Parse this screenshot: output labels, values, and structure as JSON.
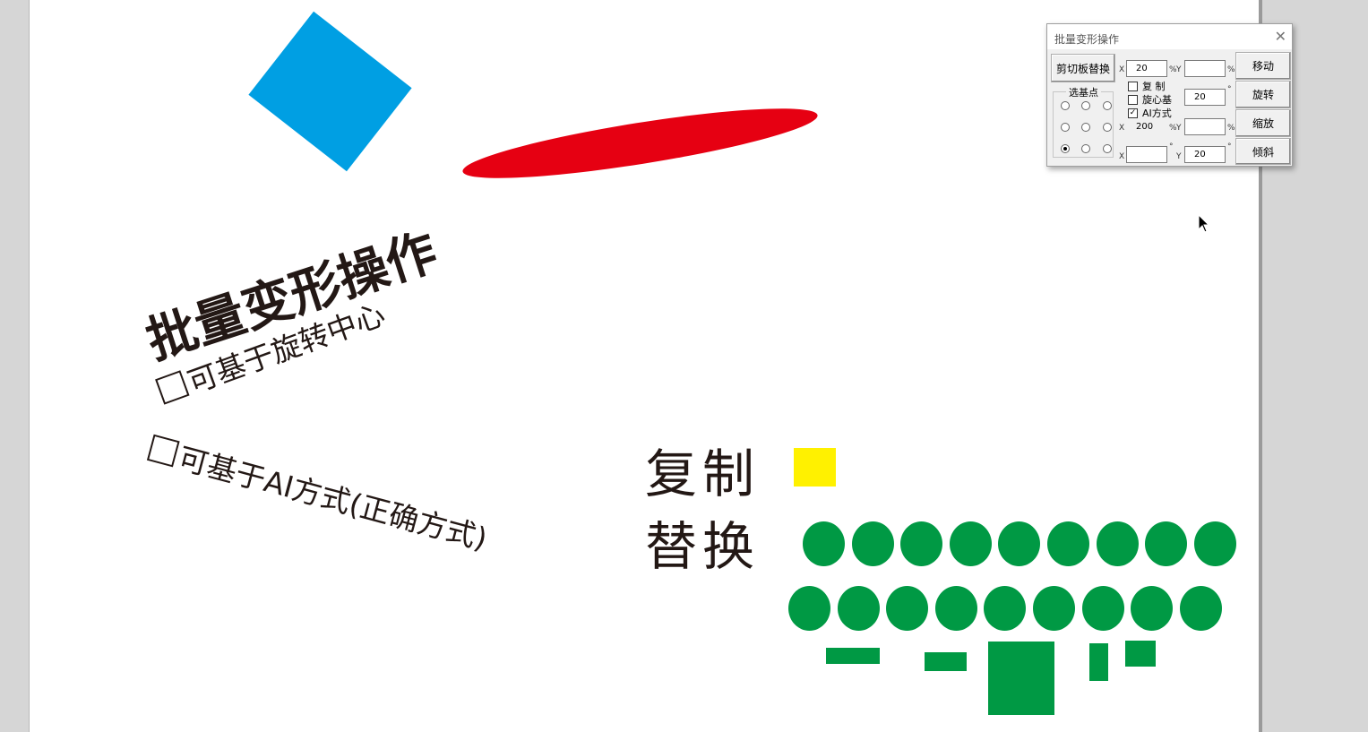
{
  "canvas": {
    "colors": {
      "blue": "#009FE3",
      "red": "#E60012",
      "yellow": "#FFF100",
      "green": "#009944",
      "text": "#231815"
    },
    "title": "批量变形操作",
    "feature_1": "可基于旋转中心",
    "feature_2": "可基于AI方式(正确方式)",
    "label_copy": "复制",
    "label_replace": "替换"
  },
  "panel": {
    "title": "批量变形操作",
    "clipboard_button": "剪切板替换",
    "base_point_group": "选基点",
    "move_x": "20",
    "move_y": "",
    "rotate_value": "20",
    "scale_x": "200",
    "scale_y": "",
    "skew_x": "",
    "skew_y": "20",
    "axis_x": "X",
    "axis_y": "Y",
    "unit_percent": "%",
    "unit_degree": "°",
    "checkbox_copy": {
      "label": "复 制",
      "checked": false
    },
    "checkbox_rotate_base": {
      "label": "旋心基",
      "checked": false
    },
    "checkbox_ai": {
      "label": "AI方式",
      "checked": true
    },
    "btn_move": "移动",
    "btn_rotate": "旋转",
    "btn_scale": "缩放",
    "btn_skew": "倾斜",
    "close_icon": "close-icon",
    "selected_base_point": "bottom-left"
  }
}
